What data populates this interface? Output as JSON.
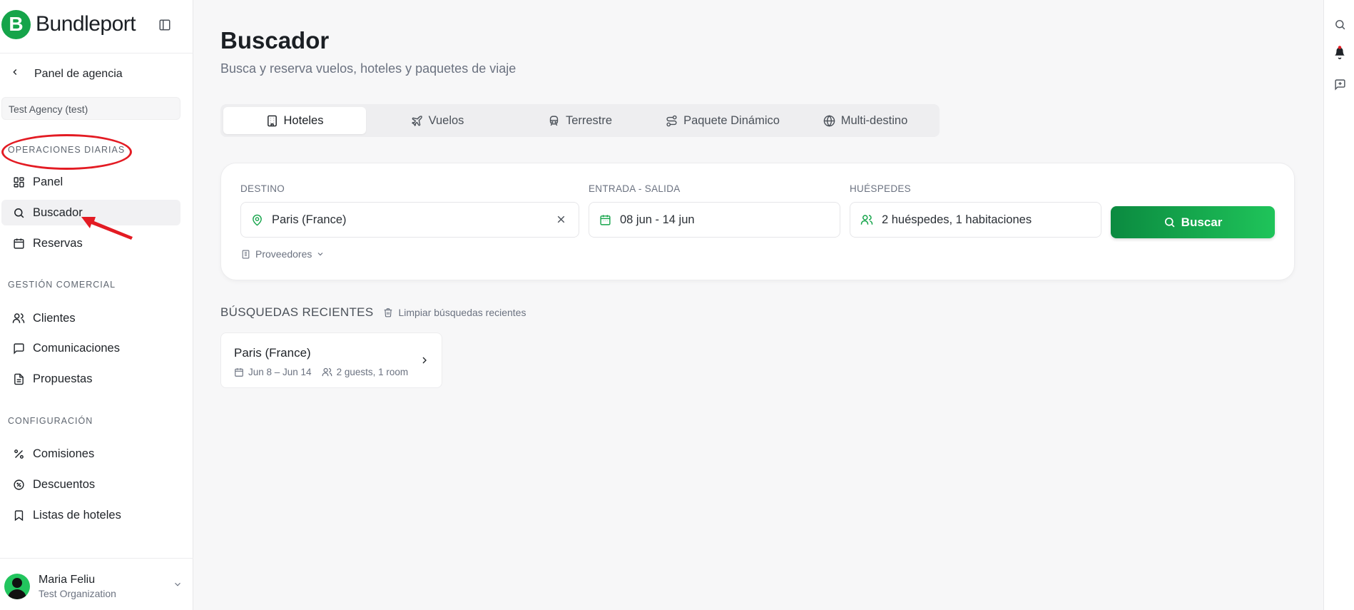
{
  "brand": {
    "logo_letter": "B",
    "name": "Bundleport"
  },
  "sidebar": {
    "back_label": "Panel de agencia",
    "agency": "Test Agency (test)",
    "sections": [
      {
        "title": "OPERACIONES DIARIAS",
        "items": [
          {
            "label": "Panel",
            "icon": "dashboard-icon"
          },
          {
            "label": "Buscador",
            "icon": "search-icon",
            "active": true
          },
          {
            "label": "Reservas",
            "icon": "calendar-icon"
          }
        ]
      },
      {
        "title": "GESTIÓN COMERCIAL",
        "items": [
          {
            "label": "Clientes",
            "icon": "users-icon"
          },
          {
            "label": "Comunicaciones",
            "icon": "message-icon"
          },
          {
            "label": "Propuestas",
            "icon": "document-icon"
          }
        ]
      },
      {
        "title": "CONFIGURACIÓN",
        "items": [
          {
            "label": "Comisiones",
            "icon": "percent-icon"
          },
          {
            "label": "Descuentos",
            "icon": "discount-icon"
          },
          {
            "label": "Listas de hoteles",
            "icon": "bookmark-icon"
          }
        ]
      }
    ],
    "user": {
      "name": "Maria Feliu",
      "org": "Test Organization"
    }
  },
  "main": {
    "title": "Buscador",
    "subtitle": "Busca y reserva vuelos, hoteles y paquetes de viaje",
    "tabs": [
      {
        "label": "Hoteles",
        "icon": "building-icon",
        "active": true
      },
      {
        "label": "Vuelos",
        "icon": "plane-icon"
      },
      {
        "label": "Terrestre",
        "icon": "bus-icon"
      },
      {
        "label": "Paquete Dinámico",
        "icon": "route-icon"
      },
      {
        "label": "Multi-destino",
        "icon": "globe-icon"
      }
    ],
    "search": {
      "destination_label": "DESTINO",
      "destination_value": "Paris (France)",
      "dates_label": "ENTRADA - SALIDA",
      "dates_value": "08 jun - 14 jun",
      "guests_label": "HUÉSPEDES",
      "guests_value": "2 huéspedes, 1 habitaciones",
      "button_label": "Buscar",
      "providers_label": "Proveedores"
    },
    "recent": {
      "title": "BÚSQUEDAS RECIENTES",
      "clear_label": "Limpiar búsquedas recientes",
      "items": [
        {
          "destination": "Paris (France)",
          "dates": "Jun 8 – Jun 14",
          "guests": "2 guests, 1 room"
        }
      ]
    }
  },
  "colors": {
    "accent": "#15a44a",
    "button_start": "#0b8a40",
    "button_end": "#1fc45a",
    "annotation": "#e31b23"
  }
}
